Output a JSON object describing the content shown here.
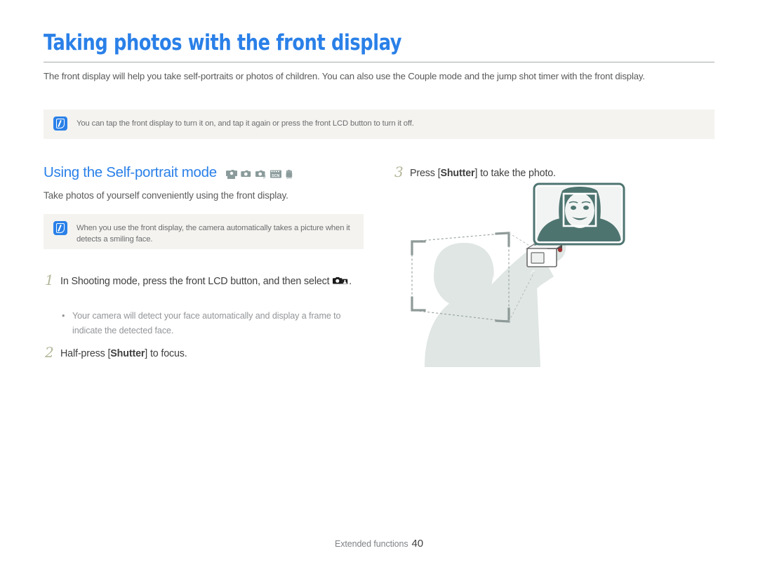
{
  "page": {
    "title": "Taking photos with the front display",
    "intro": "The front display will help you take self-portraits or photos of children. You can also use the Couple mode and the jump shot timer with the front display."
  },
  "notes": [
    {
      "icon": "note-pen-icon",
      "text": "You can tap the front display to turn it on, and tap it again or press the front LCD button to turn it off."
    },
    {
      "icon": "note-pen-icon",
      "text": "When you use the front display, the camera automatically takes a picture when it detects a smiling face."
    }
  ],
  "section": {
    "heading": "Using the Self-portrait mode",
    "mode_icons": [
      "smart-auto-mode-icon",
      "auto-camera-mode-icon",
      "program-mode-icon",
      "scene-mode-icon",
      "dis-mode-icon"
    ],
    "lead": "Take photos of yourself conveniently using the front display."
  },
  "steps": [
    {
      "number": "1",
      "text_before": "In Shooting mode, press the front LCD button, and then select ",
      "inline_icon": "self-portrait-mode-icon",
      "text_after": ".",
      "sub_bullets": [
        "Your camera will detect your face automatically and display a frame to indicate the detected face."
      ]
    },
    {
      "number": "2",
      "text_before": "Half-press [",
      "bold": "Shutter",
      "text_after": "] to focus."
    },
    {
      "number": "3",
      "text_before": "Press [",
      "bold": "Shutter",
      "text_after": "] to take the photo."
    }
  ],
  "illustration": {
    "name": "self-portrait-illustration",
    "description": "Person holding a camera at arm's length taking a self-portrait, with a callout showing the front display detecting the face",
    "callout_label": "front-display-preview",
    "face_frame_label": "face-detection-frame"
  },
  "footer": {
    "section_label": "Extended functions",
    "page_number": "40"
  },
  "colors": {
    "accent_blue": "#2a80e8",
    "body_gray": "#58595b",
    "note_bg": "#f4f3ef",
    "step_number": "#b4b79a",
    "mode_icon": "#8b9b9b",
    "illustration_light": "#dde5e3",
    "illustration_dark": "#4e7470"
  }
}
